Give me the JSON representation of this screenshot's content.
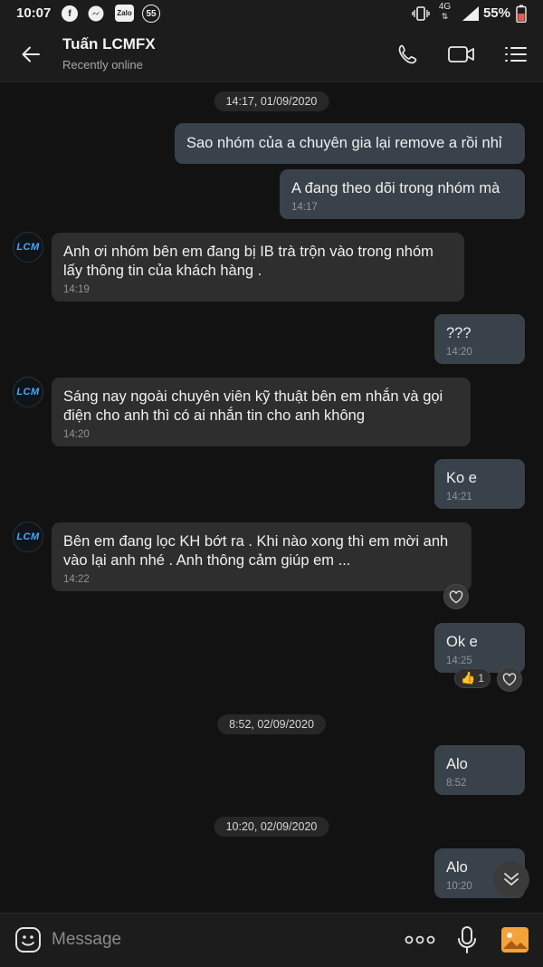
{
  "status_bar": {
    "time": "10:07",
    "app_icons": [
      "facebook-icon",
      "messenger-icon",
      "zalo-icon",
      "notification-55-icon"
    ],
    "zalo_label": "Zalo",
    "notif_count": "55",
    "network": "4G",
    "battery": "55%"
  },
  "header": {
    "title": "Tuấn LCMFX",
    "subtitle": "Recently online",
    "icons": [
      "back-arrow-icon",
      "phone-icon",
      "video-icon",
      "menu-icon"
    ]
  },
  "chat": {
    "dates": [
      "14:17, 01/09/2020",
      "8:52, 02/09/2020",
      "10:20, 02/09/2020"
    ],
    "avatar_text": "LCM",
    "messages": [
      {
        "dir": "out",
        "text": "Sao nhóm của a chuyên gia lại remove a rồi nhỉ",
        "time": ""
      },
      {
        "dir": "out",
        "text": "A đang theo dõi trong nhóm mà",
        "time": "14:17"
      },
      {
        "dir": "in",
        "text": "Anh ơi nhóm bên em đang bị IB trà trộn vào trong nhóm lấy thông tin của khách hàng .",
        "time": "14:19"
      },
      {
        "dir": "out",
        "text": "???",
        "time": "14:20"
      },
      {
        "dir": "in",
        "text": "Sáng nay ngoài chuyên viên kỹ thuật bên em nhắn và gọi điện cho anh thì có ai nhắn tin cho anh không",
        "time": "14:20"
      },
      {
        "dir": "out",
        "text": "Ko e",
        "time": "14:21"
      },
      {
        "dir": "in",
        "text": "Bên em đang lọc KH bớt ra . Khi nào xong thì em mời anh vào lại anh nhé . Anh thông cảm giúp em ...",
        "time": "14:22"
      },
      {
        "dir": "out",
        "text": "Ok e",
        "time": "14:25"
      },
      {
        "dir": "out",
        "text": "Alo",
        "time": "8:52"
      },
      {
        "dir": "out",
        "text": "Alo",
        "time": "10:20"
      }
    ],
    "reaction_count": "1"
  },
  "input_bar": {
    "placeholder": "Message",
    "icons": [
      "emoji-icon",
      "more-dots-icon",
      "microphone-icon",
      "image-icon"
    ]
  },
  "colors": {
    "background": "#121212",
    "bar": "#1c1c1c",
    "outgoing_bubble": "#39414b",
    "incoming_bubble": "#2e2e2e",
    "accent_image_icon": "#f2a33a"
  }
}
